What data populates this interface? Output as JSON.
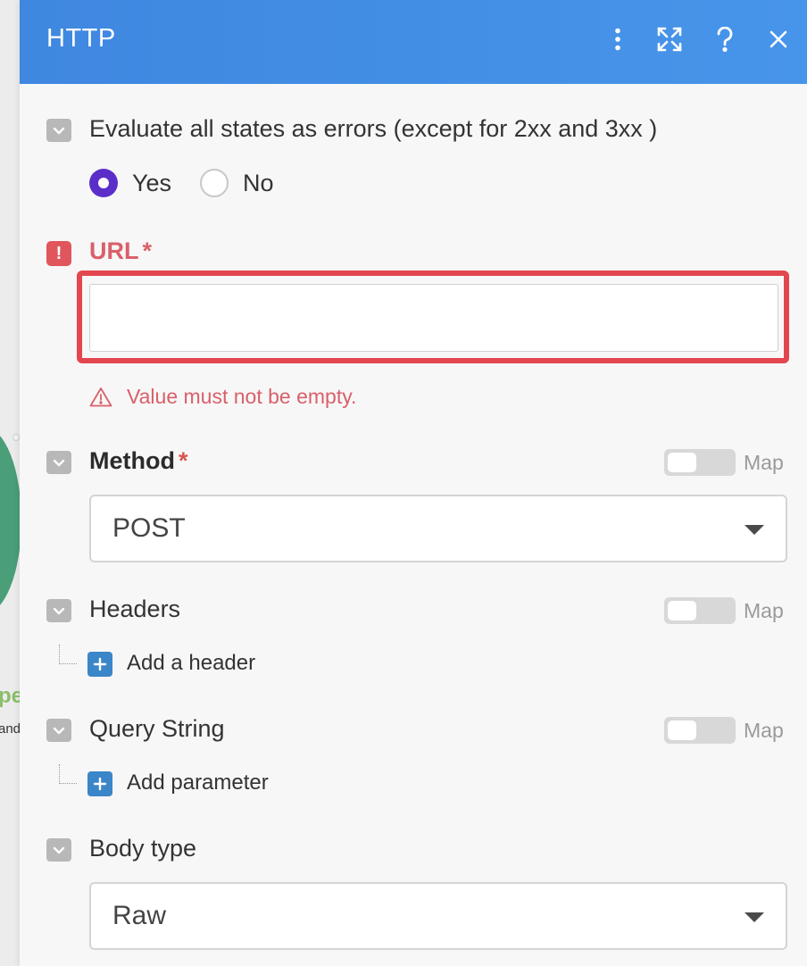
{
  "canvas": {
    "node_text_fragment": "pe",
    "node_subtext_fragment": "and"
  },
  "header": {
    "title": "HTTP",
    "icons": [
      "more-vertical-icon",
      "expand-icon",
      "help-icon",
      "close-icon"
    ],
    "gradient_colors": [
      "#3f87e0",
      "#4795ea"
    ]
  },
  "evaluate_errors": {
    "label": "Evaluate all states as errors (except for 2xx and 3xx )",
    "options": [
      {
        "label": "Yes",
        "selected": true
      },
      {
        "label": "No",
        "selected": false
      }
    ]
  },
  "url": {
    "label": "URL",
    "required_marker": "*",
    "value": "",
    "error_message": "Value must not be empty."
  },
  "method": {
    "label": "Method",
    "required_marker": "*",
    "map_label": "Map",
    "selected": "POST"
  },
  "headers": {
    "label": "Headers",
    "map_label": "Map",
    "add_label": "Add a header"
  },
  "query_string": {
    "label": "Query String",
    "map_label": "Map",
    "add_label": "Add parameter"
  },
  "body_type": {
    "label": "Body type",
    "selected": "Raw"
  },
  "colors": {
    "accent_radio": "#5b2ec9",
    "error": "#e2474f",
    "add_button": "#3a86c8"
  }
}
